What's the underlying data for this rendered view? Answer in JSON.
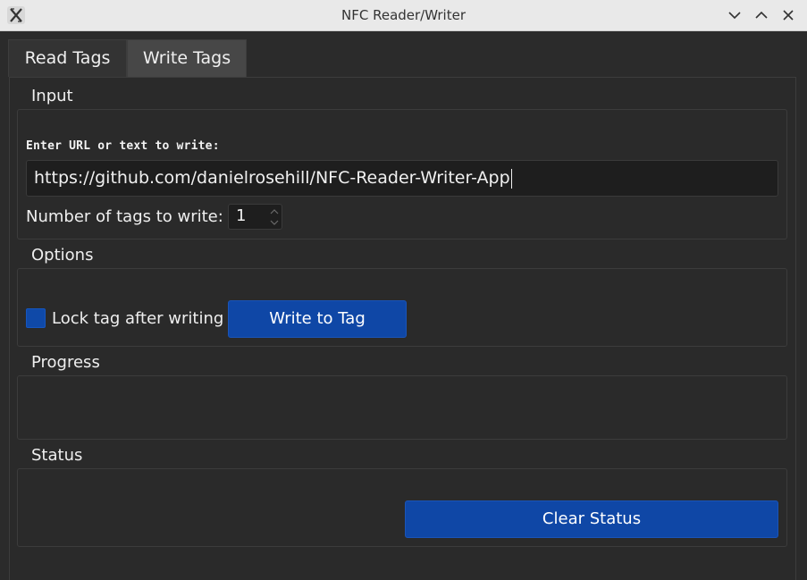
{
  "window": {
    "title": "NFC Reader/Writer",
    "icons": {
      "app": "x-app-icon",
      "minimize": "chevron-down-icon",
      "maximize": "chevron-up-icon",
      "close": "close-icon"
    }
  },
  "tabs": [
    {
      "label": "Read Tags",
      "active": false
    },
    {
      "label": "Write Tags",
      "active": true
    }
  ],
  "input_group": {
    "title": "Input",
    "prompt": "Enter URL or text to write:",
    "url_value": "https://github.com/danielrosehill/NFC-Reader-Writer-App",
    "tags_label": "Number of tags to write:",
    "tags_value": "1"
  },
  "options_group": {
    "title": "Options",
    "lock_label": "Lock tag after writing",
    "lock_checked": true,
    "write_button": "Write to Tag"
  },
  "progress_group": {
    "title": "Progress"
  },
  "status_group": {
    "title": "Status",
    "clear_button": "Clear Status"
  },
  "colors": {
    "accent": "#0f47a6",
    "background": "#2b2b2b",
    "titlebar": "#e9e9e9"
  }
}
